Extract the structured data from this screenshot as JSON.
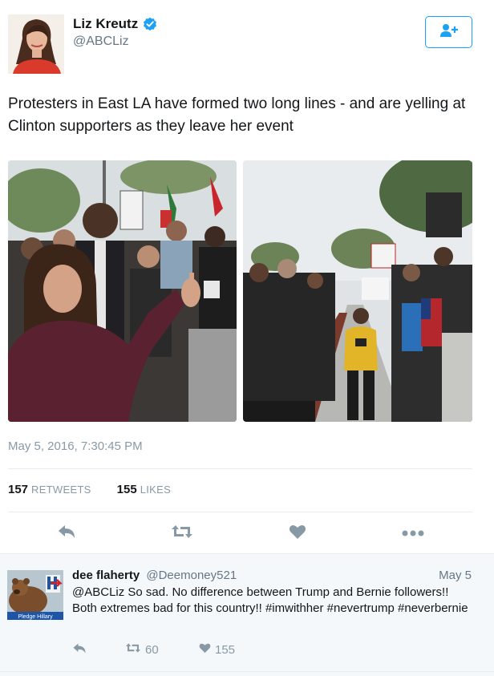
{
  "tweet": {
    "author_name": "Liz Kreutz",
    "author_handle": "@ABCLiz",
    "text": "Protesters in East LA have formed two long lines - and are yelling at Clinton supporters as they leave her event",
    "timestamp": "May 5, 2016, 7:30:45 PM",
    "retweets_count": "157",
    "retweets_label": "RETWEETS",
    "likes_count": "155",
    "likes_label": "LIKES"
  },
  "reply": {
    "author_name": "dee flaherty",
    "author_handle": "@Deemoney521",
    "date": "May 5",
    "text": "@ABCLiz So sad. No difference between Trump and Bernie followers!! Both extremes bad for this country!! #imwithher #nevertrump #neverbernie",
    "retweets_count": "60",
    "likes_count": "155",
    "avatar_badge_text": "Pledge Hillary"
  },
  "colors": {
    "accent": "#1da1f2",
    "action_gray": "#8899a6",
    "text_gray": "#657786"
  },
  "icons": {
    "verified": "verified-badge-icon",
    "follow": "add-user-icon",
    "reply": "reply-arrow-icon",
    "retweet": "retweet-icon",
    "like": "heart-icon",
    "more": "more-dots-icon"
  }
}
